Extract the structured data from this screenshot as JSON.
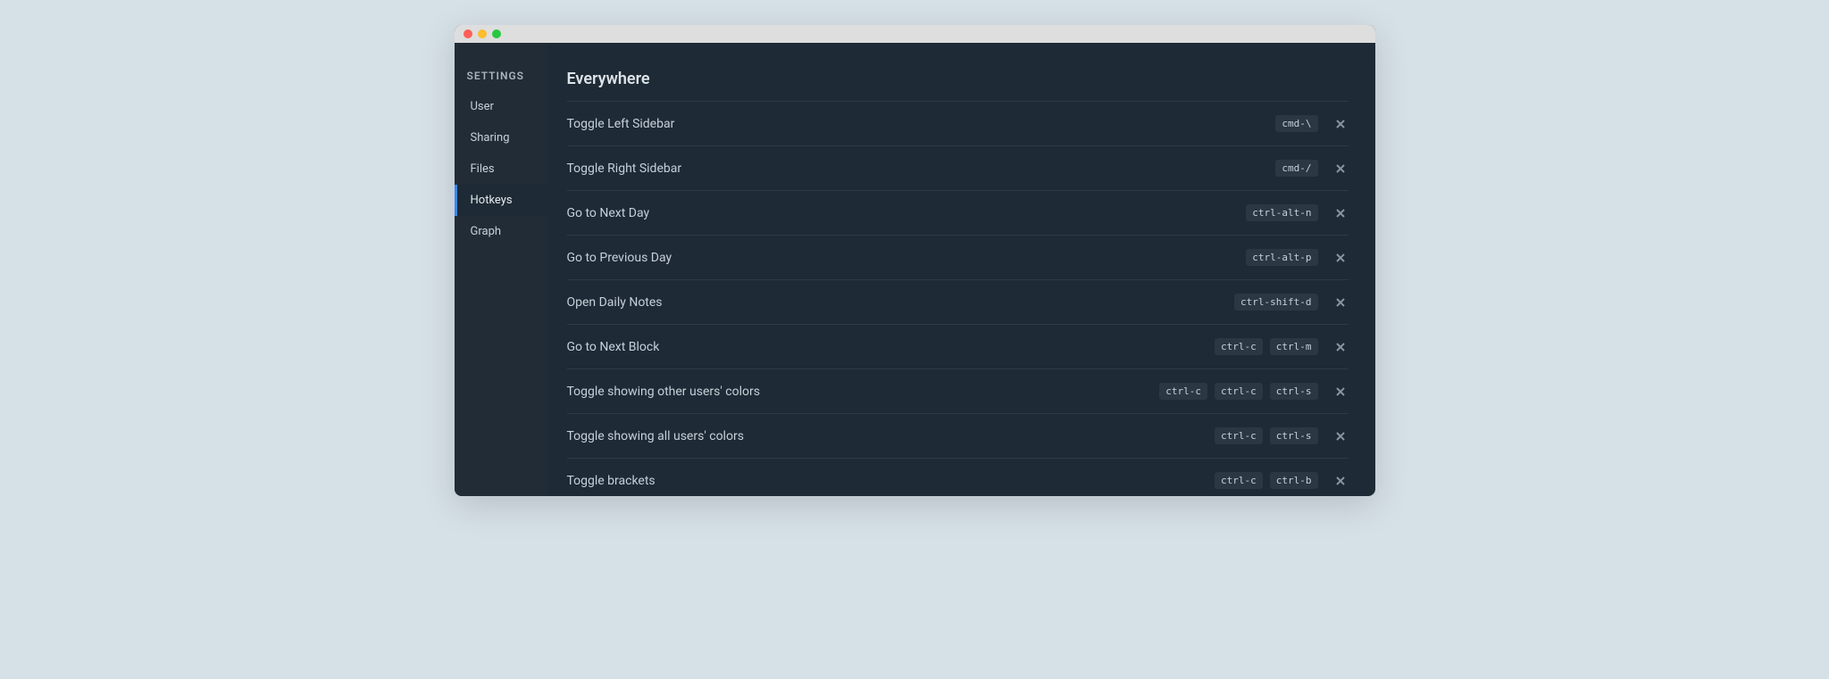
{
  "sidebar": {
    "title": "SETTINGS",
    "items": [
      {
        "label": "User",
        "active": false
      },
      {
        "label": "Sharing",
        "active": false
      },
      {
        "label": "Files",
        "active": false
      },
      {
        "label": "Hotkeys",
        "active": true
      },
      {
        "label": "Graph",
        "active": false
      }
    ]
  },
  "main": {
    "section_title": "Everywhere",
    "hotkeys": [
      {
        "label": "Toggle Left Sidebar",
        "keys": [
          "cmd-\\"
        ]
      },
      {
        "label": "Toggle Right Sidebar",
        "keys": [
          "cmd-/"
        ]
      },
      {
        "label": "Go to Next Day",
        "keys": [
          "ctrl-alt-n"
        ]
      },
      {
        "label": "Go to Previous Day",
        "keys": [
          "ctrl-alt-p"
        ]
      },
      {
        "label": "Open Daily Notes",
        "keys": [
          "ctrl-shift-d"
        ]
      },
      {
        "label": "Go to Next Block",
        "keys": [
          "ctrl-c",
          "ctrl-m"
        ]
      },
      {
        "label": "Toggle showing other users' colors",
        "keys": [
          "ctrl-c",
          "ctrl-c",
          "ctrl-s"
        ]
      },
      {
        "label": "Toggle showing all users' colors",
        "keys": [
          "ctrl-c",
          "ctrl-s"
        ]
      },
      {
        "label": "Toggle brackets",
        "keys": [
          "ctrl-c",
          "ctrl-b"
        ]
      }
    ]
  }
}
